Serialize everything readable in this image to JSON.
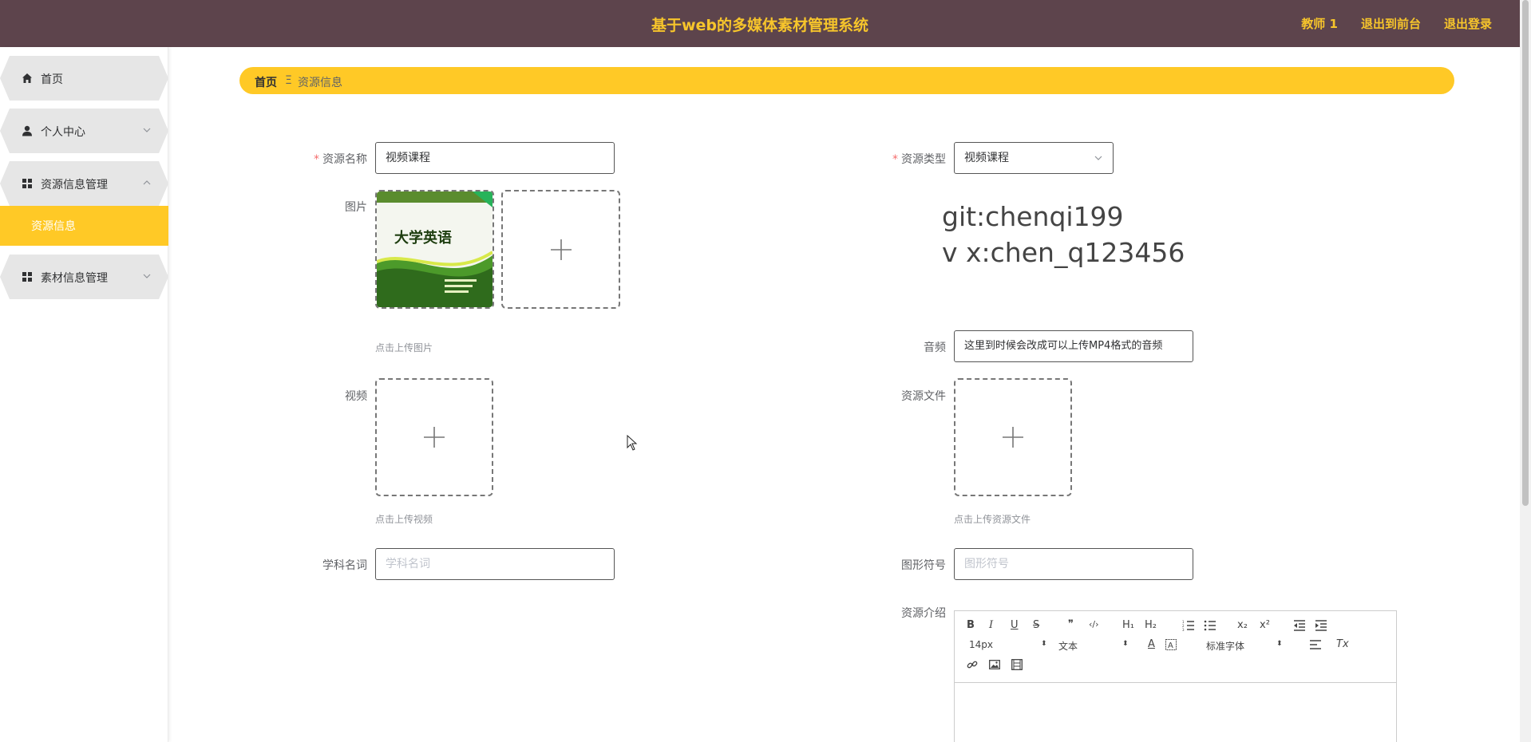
{
  "header": {
    "title": "基于web的多媒体素材管理系统",
    "user": "教师 1",
    "front_link": "退出到前台",
    "logout_link": "退出登录",
    "bg_color": "#5d444c",
    "accent_color": "#f7c52b"
  },
  "sidebar": {
    "items": [
      {
        "label": "首页",
        "icon": "home-icon"
      },
      {
        "label": "个人中心",
        "icon": "user-icon",
        "arrow": "chevron-down-icon"
      },
      {
        "label": "资源信息管理",
        "icon": "grid-icon",
        "arrow": "chevron-up-icon"
      },
      {
        "label": "素材信息管理",
        "icon": "grid-icon",
        "arrow": "chevron-down-icon"
      }
    ],
    "active_sub": "资源信息",
    "active_color": "#ffc926"
  },
  "breadcrumb": {
    "home": "首页",
    "separator": "Ξ",
    "current": "资源信息"
  },
  "form": {
    "resource_name": {
      "label": "资源名称",
      "value": "视频课程"
    },
    "resource_type": {
      "label": "资源类型",
      "value": "视频课程"
    },
    "image": {
      "label": "图片",
      "hint": "点击上传图片",
      "book_title": "大学英语"
    },
    "audio": {
      "label": "音频",
      "value": "这里到时候会改成可以上传MP4格式的音频"
    },
    "video": {
      "label": "视频",
      "hint": "点击上传视频"
    },
    "resource_file": {
      "label": "资源文件",
      "hint": "点击上传资源文件"
    },
    "subject": {
      "label": "学科名词",
      "placeholder": "学科名词"
    },
    "symbol": {
      "label": "图形符号",
      "placeholder": "图形符号"
    },
    "intro": {
      "label": "资源介绍"
    },
    "required_mark": "*"
  },
  "watermark": {
    "line1": "git:chenqi199",
    "line2": "v x:chen_q123456"
  },
  "editor": {
    "buttons": {
      "bold": "B",
      "italic": "I",
      "underline": "U",
      "strike": "S",
      "quote": "❞",
      "code": "‹/›",
      "h1": "H₁",
      "h2": "H₂",
      "sub": "x₂",
      "sup": "x²",
      "clear": "Tx",
      "font_color": "A"
    },
    "size_value": "14px",
    "para_value": "文本",
    "font_value": "标准字体"
  }
}
